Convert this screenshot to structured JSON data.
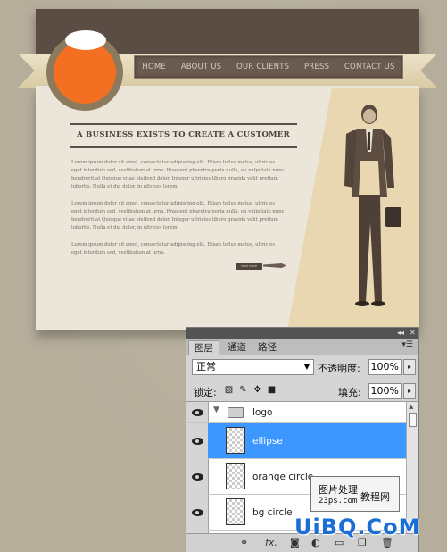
{
  "website": {
    "nav": [
      "HOME",
      "ABOUT US",
      "OUR CLIENTS",
      "PRESS",
      "CONTACT US"
    ],
    "headline": "A BUSINESS EXISTS TO CREATE A CUSTOMER",
    "paragraphs": [
      "Lorem ipsum dolor sit amet, consectetur adipiscing elit. Etiam tellus metus, ultricies eget interdum sed, vestibulum at urna. Praesent pharetra porta nulla, eu vulputate nunc hendrerit at Quisque vitae eleifend dolor. Integer ultricies libero gravida velit pretium lobortis. Nulla et dui dolor, in ultrices lorem.",
      "Lorem ipsum dolor sit amet, consectetur adipiscing elit. Etiam tellus metus, ultricies eget interdum sed, vestibulum at urna. Praesent pharetra porta nulla, eu vulputate nunc hendrerit at Quisque vitae eleifend dolor. Integer ultricies libero gravida velit pretium lobortis. Nulla et dui dolor, in ultrices lorem.",
      "Lorem ipsum dolor sit amet, consectetur adipiscing elit. Etiam tellus metus, ultricies eget interdum sed, vestibulum at urna."
    ],
    "read_more": "read more"
  },
  "panel": {
    "tabs": [
      "图层",
      "通道",
      "路径"
    ],
    "active_tab": "图层",
    "blend_mode": "正常",
    "opacity_label": "不透明度:",
    "opacity_value": "100%",
    "lock_label": "锁定:",
    "fill_label": "填充:",
    "fill_value": "100%",
    "layers": [
      {
        "name": "logo",
        "type": "group",
        "visible": true
      },
      {
        "name": "ellipse",
        "type": "layer",
        "visible": true,
        "selected": true
      },
      {
        "name": "orange circle",
        "type": "layer",
        "visible": true
      },
      {
        "name": "bg circle",
        "type": "layer",
        "visible": true
      }
    ]
  },
  "watermark": {
    "cn_text1": "图片处理",
    "cn_text2": "教程网",
    "url": "23ps.com",
    "logo_text": "UiBQ.CoM"
  },
  "colors": {
    "logo_orange": "#f36f21",
    "header_brown": "#5b4d44",
    "selection_blue": "#3c97ff",
    "watermark_blue": "#1a6fd6"
  }
}
